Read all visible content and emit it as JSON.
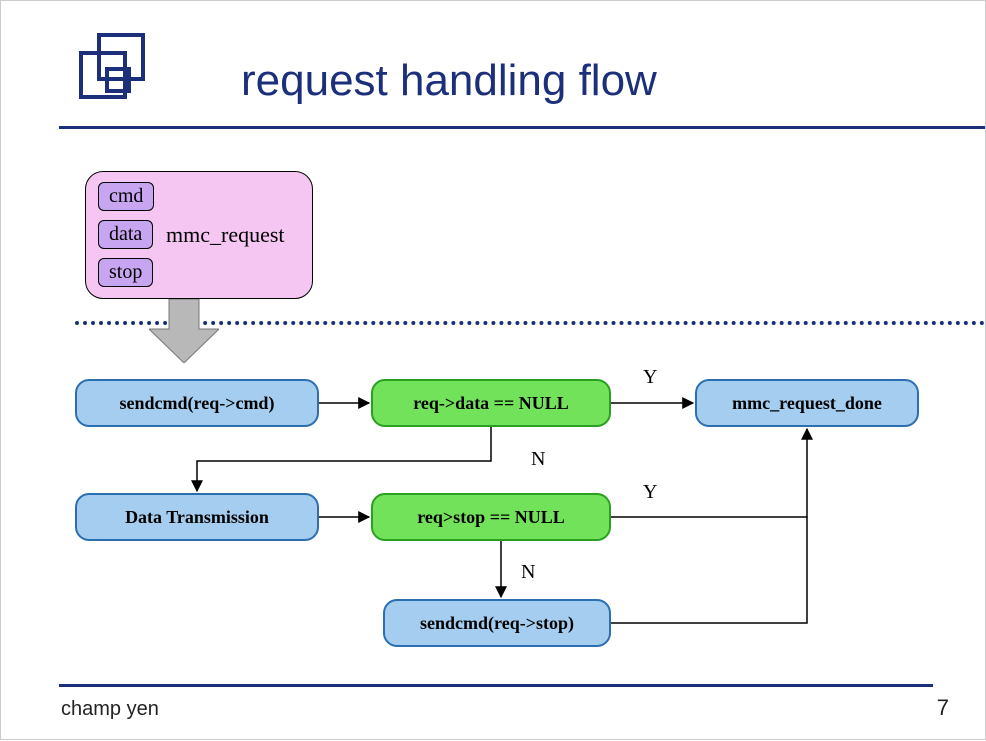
{
  "title": "request handling flow",
  "mmc": {
    "label": "mmc_request",
    "cmd": "cmd",
    "data": "data",
    "stop": "stop"
  },
  "nodes": {
    "sendcmd": "sendcmd(req->cmd)",
    "reqdata": "req->data == NULL",
    "done": "mmc_request_done",
    "datax": "Data Transmission",
    "reqstop": "req>stop == NULL",
    "sendstop": "sendcmd(req->stop)"
  },
  "edges": {
    "y1": "Y",
    "n1": "N",
    "y2": "Y",
    "n2": "N"
  },
  "footer": {
    "author": "champ yen",
    "page": "7"
  }
}
